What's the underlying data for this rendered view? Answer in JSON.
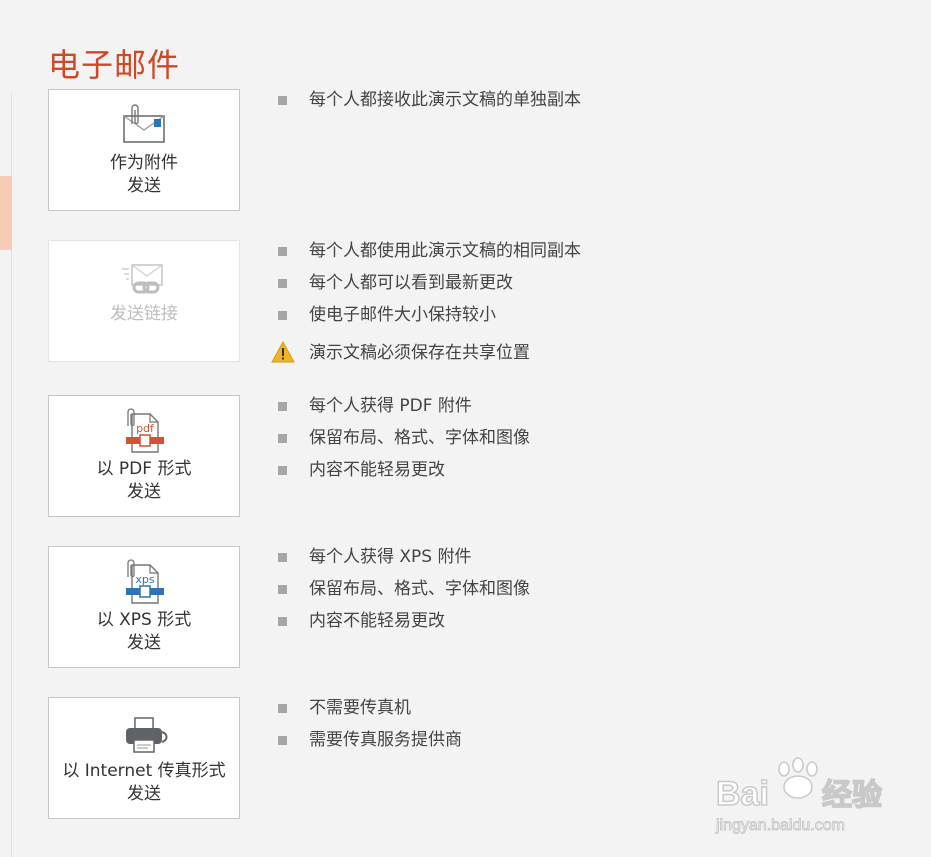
{
  "page": {
    "title": "电子邮件"
  },
  "options": [
    {
      "label_line1": "作为附件",
      "label_line2": "发送",
      "icon": "envelope-attachment-icon",
      "bullets": [
        "每个人都接收此演示文稿的单独副本"
      ]
    },
    {
      "label_line1": "发送链接",
      "label_line2": "",
      "icon": "link-envelope-icon",
      "disabled": true,
      "bullets": [
        "每个人都使用此演示文稿的相同副本",
        "每个人都可以看到最新更改",
        "使电子邮件大小保持较小"
      ],
      "warning": "演示文稿必须保存在共享位置"
    },
    {
      "label_line1": "以 PDF 形式",
      "label_line2": "发送",
      "icon": "pdf-file-icon",
      "icon_text": "pdf",
      "bullets": [
        "每个人获得 PDF 附件",
        "保留布局、格式、字体和图像",
        "内容不能轻易更改"
      ]
    },
    {
      "label_line1": "以 XPS 形式",
      "label_line2": "发送",
      "icon": "xps-file-icon",
      "icon_text": "xps",
      "bullets": [
        "每个人获得 XPS 附件",
        "保留布局、格式、字体和图像",
        "内容不能轻易更改"
      ]
    },
    {
      "label_line1": "以 Internet 传真形式",
      "label_line2": "发送",
      "icon": "fax-printer-icon",
      "bullets": [
        "不需要传真机",
        "需要传真服务提供商"
      ]
    }
  ],
  "watermark": {
    "brand": "Bai",
    "brand_cn": "经验",
    "url": "jingyan.baidu.com"
  },
  "colors": {
    "accent": "#d24726",
    "pdf": "#d35230",
    "xps": "#2e75b6",
    "bullet": "#a6a6a6",
    "warning": "#f0b429"
  }
}
